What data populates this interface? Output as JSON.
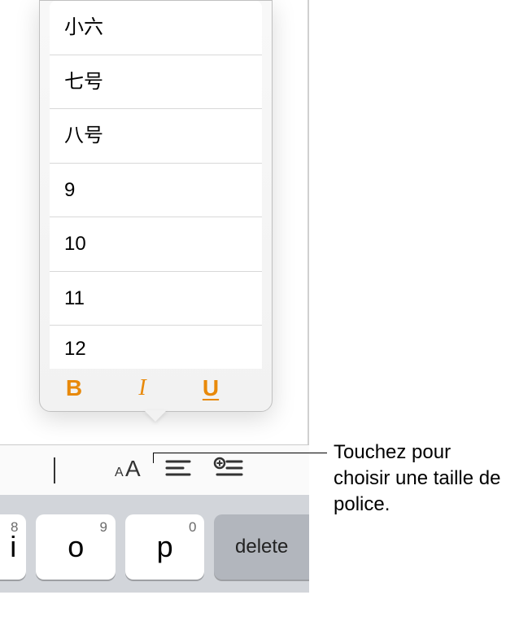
{
  "sizes": {
    "item0": "小六",
    "item1": "七号",
    "item2": "八号",
    "item3": "9",
    "item4": "10",
    "item5": "11",
    "item6": "12"
  },
  "styles": {
    "bold": "B",
    "italic": "I",
    "underline": "U"
  },
  "keys": {
    "k0_alt": "8",
    "k0_main": "i",
    "k1_alt": "9",
    "k1_main": "o",
    "k2_alt": "0",
    "k2_main": "p",
    "delete": "delete"
  },
  "callout": "Touchez pour choisir une taille de police."
}
